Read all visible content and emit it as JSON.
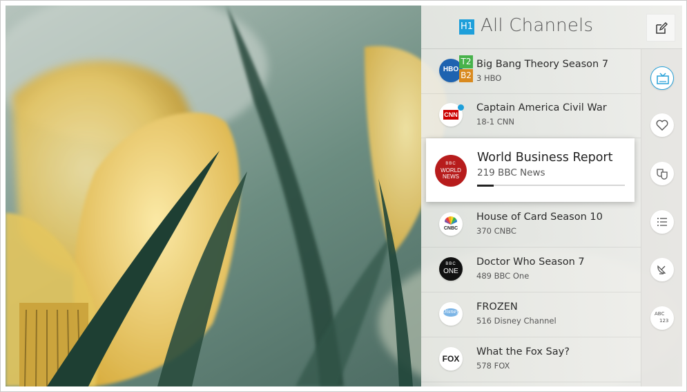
{
  "header": {
    "badge": "H1",
    "title": "All Channels"
  },
  "channels": [
    {
      "title": "Big Bang Theory Season 7",
      "sub": "3  HBO",
      "logo": "HBO",
      "tags": [
        "T2",
        "B2"
      ]
    },
    {
      "title": "Captain America  Civil War",
      "sub": "18-1  CNN",
      "logo": "CNN"
    },
    {
      "title": "World Business Report",
      "sub": "219  BBC News",
      "logo_lines": [
        "BBC",
        "WORLD",
        "NEWS"
      ],
      "progress": 0.11
    },
    {
      "title": "House of Card Season 10",
      "sub": "370  CNBC",
      "logo": "CNBC"
    },
    {
      "title": "Doctor Who Season 7",
      "sub": "489  BBC One",
      "logo_lines": [
        "BBC",
        "ONE"
      ]
    },
    {
      "title": "FROZEN",
      "sub": "516  Disney Channel",
      "logo": "Disney"
    },
    {
      "title": "What the Fox Say?",
      "sub": "578  FOX",
      "logo": "FOX"
    }
  ],
  "sidebar_icons": [
    "tv-icon",
    "heart-icon",
    "theater-masks-icon",
    "list-icon",
    "satellite-dish-icon",
    "abc-123-icon"
  ],
  "sidebar_labels": {
    "abc": "ABC",
    "num": "123"
  },
  "colors": {
    "accent": "#25a0d8",
    "badge": "#1e9fda",
    "tag_t2": "#47b24a",
    "tag_b2": "#d98a1f",
    "bbc_news": "#b71c1c"
  }
}
